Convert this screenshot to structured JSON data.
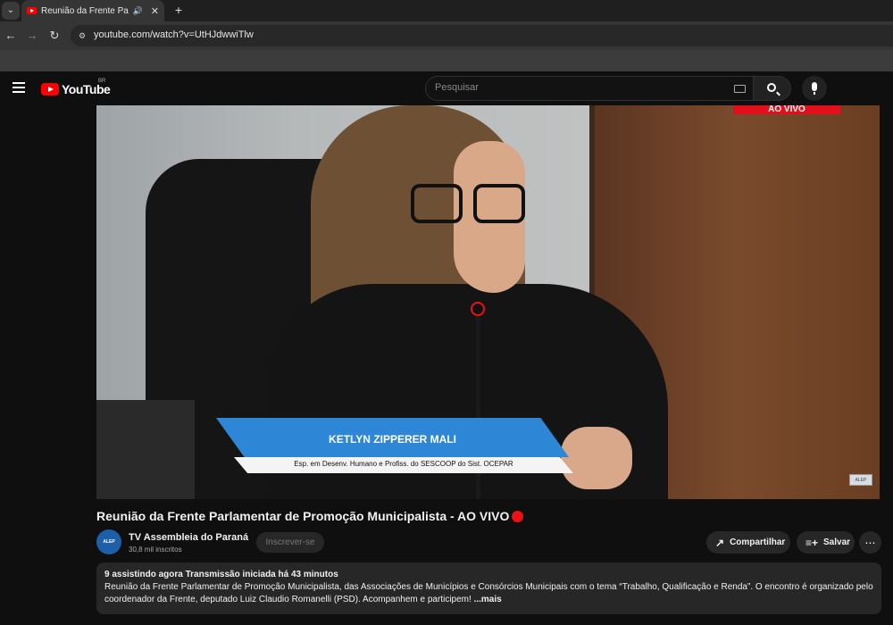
{
  "browser": {
    "tab_title": "Reunião da Frente Parlamentar",
    "url": "youtube.com/watch?v=UtHJdwwiTlw"
  },
  "masthead": {
    "logo_text": "YouTube",
    "country": "BR",
    "search_placeholder": "Pesquisar"
  },
  "video": {
    "live_badge": "AO VIVO",
    "lower_third_name": "KETLYN ZIPPERER MALI",
    "lower_third_role": "Esp. em Desenv. Humano e Profiss. do SESCOOP do Sist. OCEPAR",
    "title": "Reunião da Frente Parlamentar de Promoção Municipalista - AO VIVO"
  },
  "channel": {
    "name": "TV Assembleia do Paraná",
    "subscribers": "30,8 mil inscritos",
    "subscribe_label": "Inscrever-se"
  },
  "actions": {
    "share_label": "Compartilhar",
    "save_label": "Salvar",
    "more_label": "⋯"
  },
  "description": {
    "stats": "9 assistindo agora  Transmissão iniciada há 43 minutos",
    "text": "Reunião da Frente Parlamentar de Promoção Municipalista, das Associações de Municípios e Consórcios Municipais com o tema “Trabalho, Qualificação e Renda”. O encontro é organizado pelo coordenador da Frente, deputado Luiz Claudio Romanelli (PSD). Acompanhem e participem!",
    "more": "...mais"
  },
  "colors": {
    "brand_red": "#ff0000",
    "live_red": "#e2101a",
    "lower_third_blue": "#2e86d6"
  }
}
